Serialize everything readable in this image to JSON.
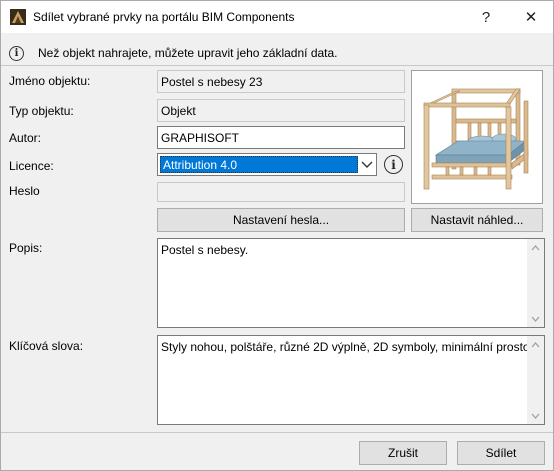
{
  "window": {
    "title": "Sdílet vybrané prvky na portálu BIM Components",
    "help_label": "?",
    "close_label": "✕"
  },
  "info": {
    "message": "Než objekt nahrajete, můžete upravit jeho základní data."
  },
  "form": {
    "object_name_label": "Jméno objektu:",
    "object_name_value": "Postel s nebesy 23",
    "object_type_label": "Typ objektu:",
    "object_type_value": "Objekt",
    "author_label": "Autor:",
    "author_value": "GRAPHISOFT",
    "license_label": "Licence:",
    "license_value": "Attribution 4.0",
    "password_label": "Heslo",
    "password_value": "",
    "description_label": "Popis:",
    "description_value": "Postel s nebesy.",
    "keywords_label": "Klíčová slova:",
    "keywords_value": "Styly nohou, polštáře, různé 2D výplně, 2D symboly, minimální prostor"
  },
  "buttons": {
    "password_settings": "Nastavení hesla...",
    "set_preview": "Nastavit náhled...",
    "cancel": "Zrušit",
    "share": "Sdílet"
  },
  "colors": {
    "selection": "#0078d7",
    "dialog_bg": "#f0f0f0",
    "wood": "#d9b98d",
    "mattress": "#8fb4c9"
  }
}
